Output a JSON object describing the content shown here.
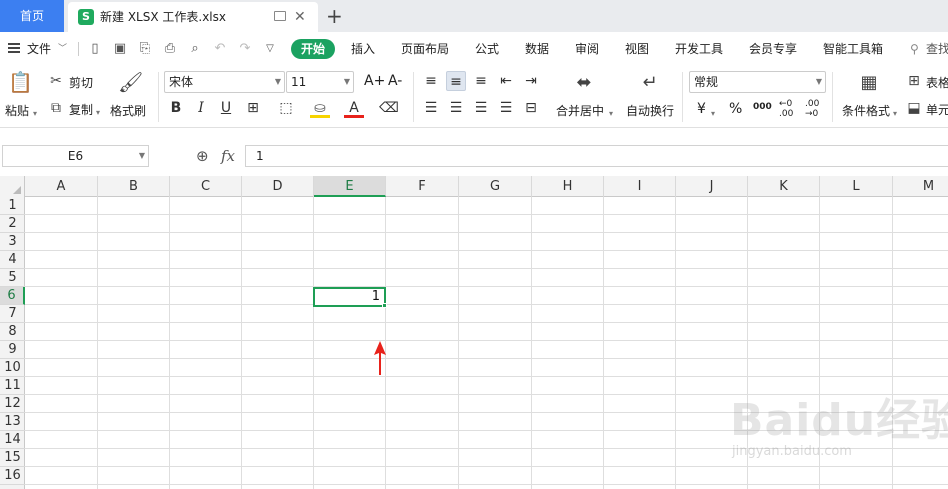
{
  "tabs": {
    "home_label": "首页",
    "doc_icon_letter": "S",
    "doc_title": "新建 XLSX 工作表.xlsx",
    "close_glyph": "✕",
    "new_tab_glyph": "+"
  },
  "menu": {
    "file_label": "文件",
    "active_tab": "开始",
    "tabs": [
      "插入",
      "页面布局",
      "公式",
      "数据",
      "审阅",
      "视图",
      "开发工具",
      "会员专享",
      "智能工具箱"
    ],
    "search_label": "查找"
  },
  "ribbon": {
    "paste_label": "粘贴",
    "cut_label": "剪切",
    "copy_label": "复制",
    "format_painter_label": "格式刷",
    "font_name": "宋体",
    "font_size": "11",
    "grow_font": "A+",
    "shrink_font": "A-",
    "bold": "B",
    "italic": "I",
    "underline": "U",
    "merge_label": "合并居中",
    "wrap_label": "自动换行",
    "number_format": "常规",
    "currency": "¥",
    "percent": "%",
    "thousands": "000",
    "conditional_label": "条件格式",
    "table_style_label": "表格",
    "cell_label": "单元"
  },
  "formula": {
    "name_box": "E6",
    "fx_label": "fx",
    "value": "1"
  },
  "sheet": {
    "columns": [
      "A",
      "B",
      "C",
      "D",
      "E",
      "F",
      "G",
      "H",
      "I",
      "J",
      "K",
      "L",
      "M"
    ],
    "rows": [
      "1",
      "2",
      "3",
      "4",
      "5",
      "6",
      "7",
      "8",
      "9",
      "10",
      "11",
      "12",
      "13",
      "14",
      "15",
      "16"
    ],
    "selected_column": "E",
    "selected_row": "6",
    "active_cell_value": "1",
    "annotation_color": "#e8221b"
  },
  "watermark": {
    "main": "Baidu经验",
    "sub": "jingyan.baidu.com"
  }
}
